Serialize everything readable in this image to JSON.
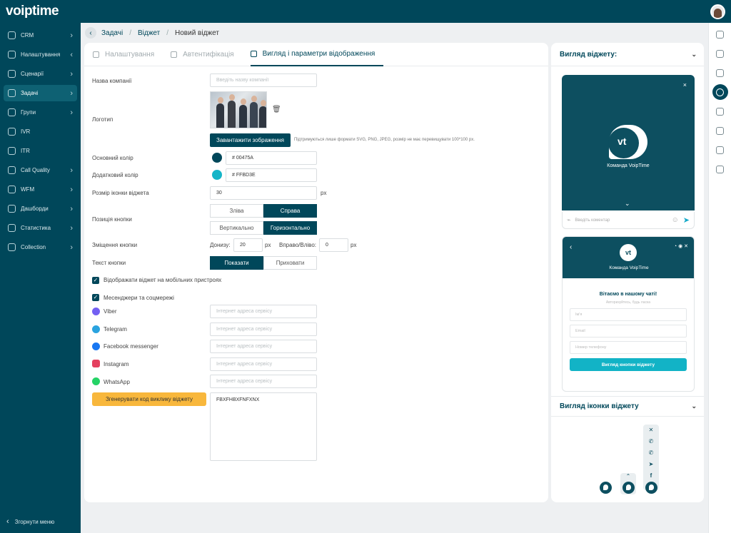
{
  "app": {
    "logo": "voiptime"
  },
  "sidebar": {
    "items": [
      {
        "label": "CRM",
        "arrow": "›"
      },
      {
        "label": "Налаштування",
        "arrow": "‹"
      },
      {
        "label": "Сценарії",
        "arrow": "›"
      },
      {
        "label": "Задачі",
        "arrow": "›",
        "active": true
      },
      {
        "label": "Групи",
        "arrow": "›"
      },
      {
        "label": "IVR",
        "arrow": ""
      },
      {
        "label": "ITR",
        "arrow": ""
      },
      {
        "label": "Call Quality",
        "arrow": "›"
      },
      {
        "label": "WFM",
        "arrow": "›"
      },
      {
        "label": "Дашборди",
        "arrow": "›"
      },
      {
        "label": "Статистика",
        "arrow": "›"
      },
      {
        "label": "Collection",
        "arrow": "›"
      }
    ],
    "collapse_label": "Згорнути меню"
  },
  "breadcrumb": {
    "items": [
      "Задачі",
      "Віджет",
      "Новий віджет"
    ],
    "sep": "/"
  },
  "tabs": [
    "Налаштування",
    "Автентифікація",
    "Вигляд і параметри відображення"
  ],
  "form": {
    "company_label": "Назва компанії",
    "company_placeholder": "Введіть назву компанії",
    "logo_label": "Логотип",
    "upload_button": "Завантажити зображення",
    "upload_hint": "Підтримуються лише формати SVG, PNG, JPEG, розмір не має перевищувати 100*100 px.",
    "primary_label": "Основний колір",
    "primary_value": "# 00475A",
    "primary_color": "#00475a",
    "secondary_label": "Додатковий колір",
    "secondary_value": "# FFBD3E",
    "secondary_color": "#15b5c8",
    "icon_size_label": "Розмір іконки віджета",
    "icon_size_value": "30",
    "px": "px",
    "position_label": "Позиція кнопки",
    "left": "Зліва",
    "right": "Справа",
    "vertical": "Вертикально",
    "horizontal": "Горизонтально",
    "offset_label": "Зміщення кнопки",
    "down_label": "Донизу:",
    "down_value": "20",
    "side_label": "Вправо/Вліво:",
    "side_value": "0",
    "text_label": "Текст кнопки",
    "show": "Показати",
    "hide": "Приховати",
    "mobile_label": "Відображати віджет на мобільних пристроях",
    "messengers_label": "Месенджери та соцмережі",
    "check_mark": "✓",
    "service_placeholder": "Інтернет адреса сервісу",
    "messengers": [
      {
        "name": "Viber",
        "color": "#7360f2"
      },
      {
        "name": "Telegram",
        "color": "#2aa3df"
      },
      {
        "name": "Facebook messenger",
        "color": "#1877f2"
      },
      {
        "name": "Instagram",
        "color": "#e4405f"
      },
      {
        "name": "WhatsApp",
        "color": "#25d366"
      }
    ],
    "generate_button": "Згенерувати код виклику віджету",
    "code": "FBXFHBXFNFXNX"
  },
  "preview": {
    "title": "Вигляд віджету:",
    "close": "×",
    "team": "Команда VoipTime",
    "logo_text": "vt",
    "comment_placeholder": "Введіть коментар",
    "welcome": "Вітаємо в нашому чаті!",
    "subtitle": "Авторизуйтесь, будь ласка",
    "fields": [
      "Ім'я",
      "Email",
      "Номер телефону"
    ],
    "submit": "Вигляд кнопки віджету",
    "icon_title": "Вигляд іконки віджету",
    "chevron": "⌄"
  },
  "rightbar_icons": [
    "bell-icon",
    "phone-icon",
    "document-icon",
    "clock-icon",
    "chat-icon",
    "calendar-icon",
    "mail-icon",
    "messages-icon"
  ]
}
